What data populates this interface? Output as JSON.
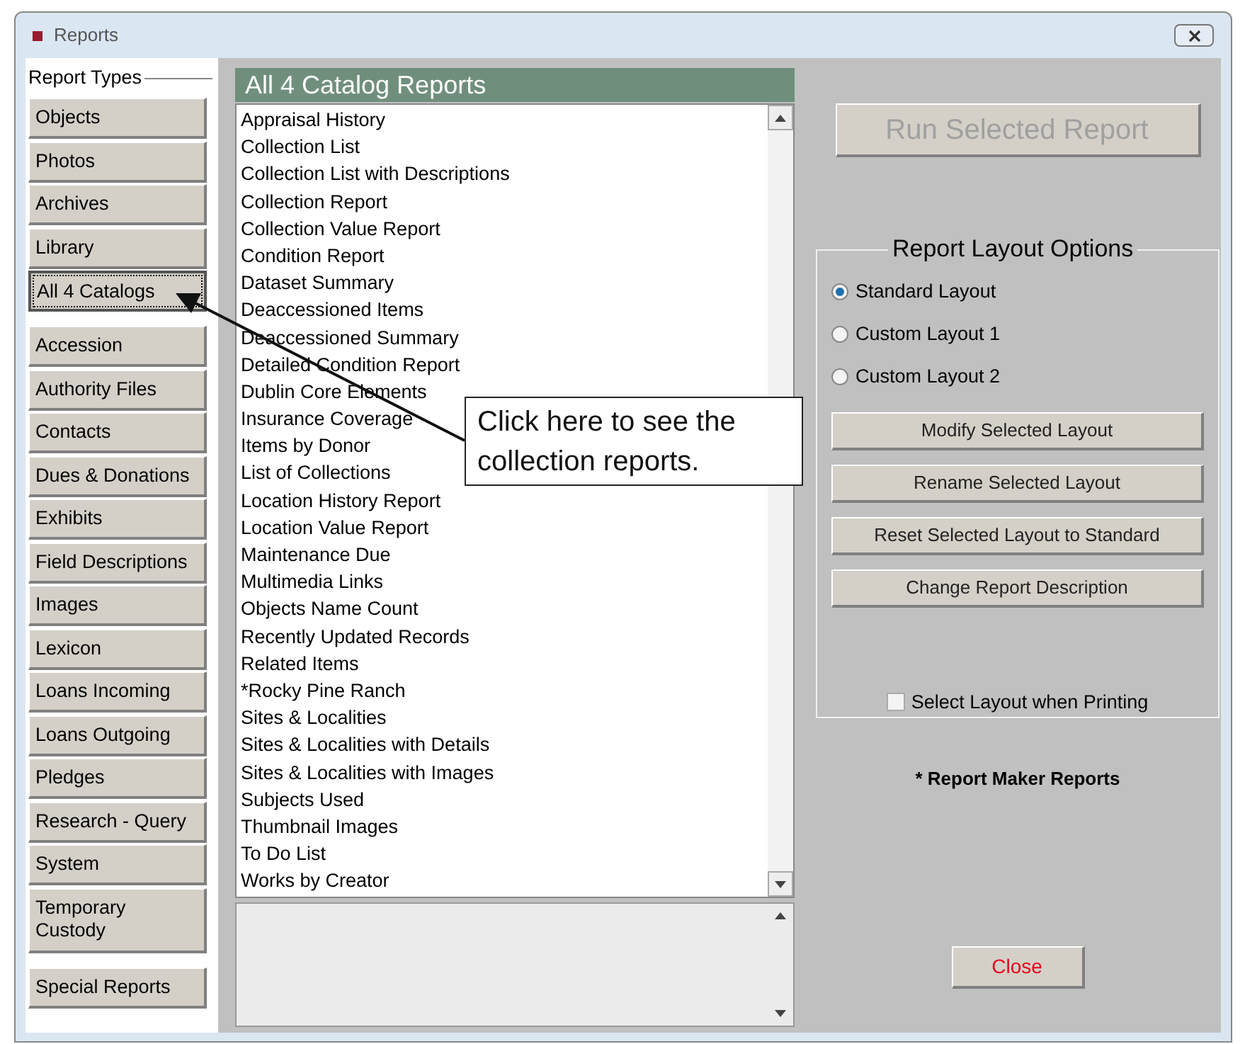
{
  "window": {
    "title": "Reports"
  },
  "report_types": {
    "label": "Report Types",
    "groups": [
      {
        "items": [
          {
            "label": "Objects",
            "selected": false
          },
          {
            "label": "Photos",
            "selected": false
          },
          {
            "label": "Archives",
            "selected": false
          },
          {
            "label": "Library",
            "selected": false
          },
          {
            "label": "All 4 Catalogs",
            "selected": true
          }
        ]
      },
      {
        "items": [
          {
            "label": "Accession",
            "selected": false
          },
          {
            "label": "Authority Files",
            "selected": false
          },
          {
            "label": "Contacts",
            "selected": false
          },
          {
            "label": "Dues & Donations",
            "selected": false
          },
          {
            "label": "Exhibits",
            "selected": false
          },
          {
            "label": "Field Descriptions",
            "selected": false
          },
          {
            "label": "Images",
            "selected": false
          },
          {
            "label": "Lexicon",
            "selected": false
          },
          {
            "label": "Loans Incoming",
            "selected": false
          },
          {
            "label": "Loans Outgoing",
            "selected": false
          },
          {
            "label": "Pledges",
            "selected": false
          },
          {
            "label": "Research - Query",
            "selected": false
          },
          {
            "label": "System",
            "selected": false
          },
          {
            "label": "Temporary Custody",
            "selected": false,
            "kind": "two_line"
          }
        ]
      },
      {
        "items": [
          {
            "label": "Special Reports",
            "selected": false
          }
        ]
      }
    ]
  },
  "report_list": {
    "title": "All 4 Catalog Reports",
    "items": [
      "Appraisal History",
      "Collection List",
      "Collection List with Descriptions",
      "Collection Report",
      "Collection Value Report",
      "Condition Report",
      "Dataset Summary",
      "Deaccessioned Items",
      "Deaccessioned Summary",
      "Detailed Condition Report",
      "Dublin Core Elements",
      "Insurance Coverage",
      "Items by Donor",
      "List of Collections",
      "Location History Report",
      "Location Value Report",
      "Maintenance Due",
      "Multimedia Links",
      "Objects Name Count",
      "Recently Updated Records",
      "Related Items",
      "*Rocky Pine Ranch",
      "Sites & Localities",
      "Sites & Localities with Details",
      "Sites & Localities with Images",
      "Subjects Used",
      "Thumbnail Images",
      "To Do List",
      "Works by Creator"
    ]
  },
  "run_button": {
    "label": "Run Selected Report",
    "disabled": true
  },
  "layout_options": {
    "title": "Report Layout Options",
    "radios": [
      {
        "label": "Standard Layout",
        "selected": true
      },
      {
        "label": "Custom Layout 1",
        "selected": false
      },
      {
        "label": "Custom Layout 2",
        "selected": false
      }
    ],
    "buttons": [
      "Modify Selected Layout",
      "Rename Selected Layout",
      "Reset Selected Layout to Standard",
      "Change Report Description"
    ],
    "print_checkbox": {
      "label": "Select Layout when Printing",
      "checked": false
    }
  },
  "footnote": "* Report Maker Reports",
  "close_button": "Close",
  "callout": {
    "text": "Click here to see the collection reports."
  }
}
